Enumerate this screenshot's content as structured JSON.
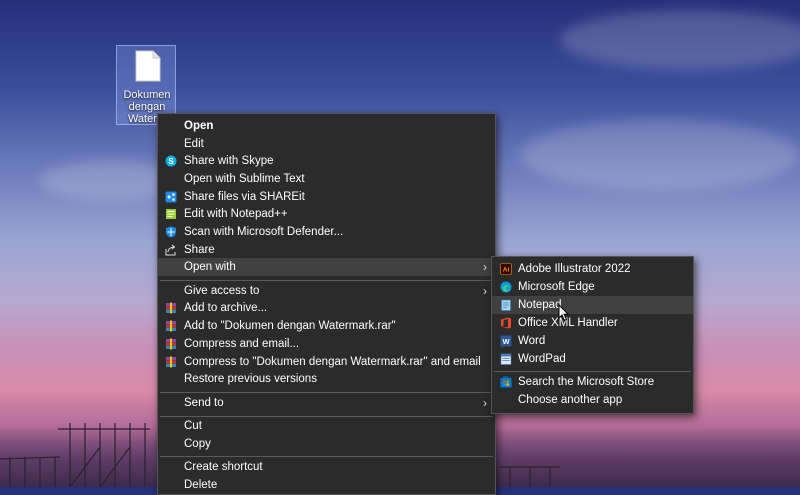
{
  "desktop": {
    "file_icon": {
      "name": "Dokumen dengan Watermark",
      "label_lines": [
        "Dokumen",
        "dengan",
        "Waterm"
      ]
    }
  },
  "context_menu": {
    "items": [
      {
        "label": "Open",
        "icon": "none",
        "bold": true
      },
      {
        "label": "Edit",
        "icon": "none"
      },
      {
        "label": "Share with Skype",
        "icon": "skype-icon"
      },
      {
        "label": "Open with Sublime Text",
        "icon": "none"
      },
      {
        "label": "Share files via SHAREit",
        "icon": "shareit-icon"
      },
      {
        "label": "Edit with Notepad++",
        "icon": "notepadpp-icon"
      },
      {
        "label": "Scan with Microsoft Defender...",
        "icon": "defender-icon"
      },
      {
        "label": "Share",
        "icon": "share-icon"
      },
      {
        "label": "Open with",
        "icon": "none",
        "submenu": true,
        "highlighted": true
      },
      {
        "label": "Give access to",
        "icon": "none",
        "submenu": true
      },
      {
        "label": "Add to archive...",
        "icon": "winrar-icon"
      },
      {
        "label": "Add to \"Dokumen dengan Watermark.rar\"",
        "icon": "winrar-icon"
      },
      {
        "label": "Compress and email...",
        "icon": "winrar-icon"
      },
      {
        "label": "Compress to \"Dokumen dengan Watermark.rar\" and email",
        "icon": "winrar-icon"
      },
      {
        "label": "Restore previous versions",
        "icon": "none"
      },
      {
        "label": "Send to",
        "icon": "none",
        "submenu": true
      },
      {
        "label": "Cut",
        "icon": "none"
      },
      {
        "label": "Copy",
        "icon": "none"
      },
      {
        "label": "Create shortcut",
        "icon": "none"
      },
      {
        "label": "Delete",
        "icon": "none"
      }
    ]
  },
  "open_with_submenu": {
    "items": [
      {
        "label": "Adobe Illustrator 2022",
        "icon": "illustrator-icon",
        "icon_text": "Ai"
      },
      {
        "label": "Microsoft Edge",
        "icon": "edge-icon"
      },
      {
        "label": "Notepad",
        "icon": "notepad-icon",
        "highlighted": true
      },
      {
        "label": "Office XML Handler",
        "icon": "office-icon"
      },
      {
        "label": "Word",
        "icon": "word-icon",
        "icon_text": "W"
      },
      {
        "label": "WordPad",
        "icon": "wordpad-icon"
      },
      {
        "label": "Search the Microsoft Store",
        "icon": "store-icon"
      },
      {
        "label": "Choose another app",
        "icon": "none"
      }
    ]
  },
  "colors": {
    "menu_bg": "#2b2b2b",
    "menu_highlight": "#414141",
    "separator": "#5a5a5a"
  }
}
